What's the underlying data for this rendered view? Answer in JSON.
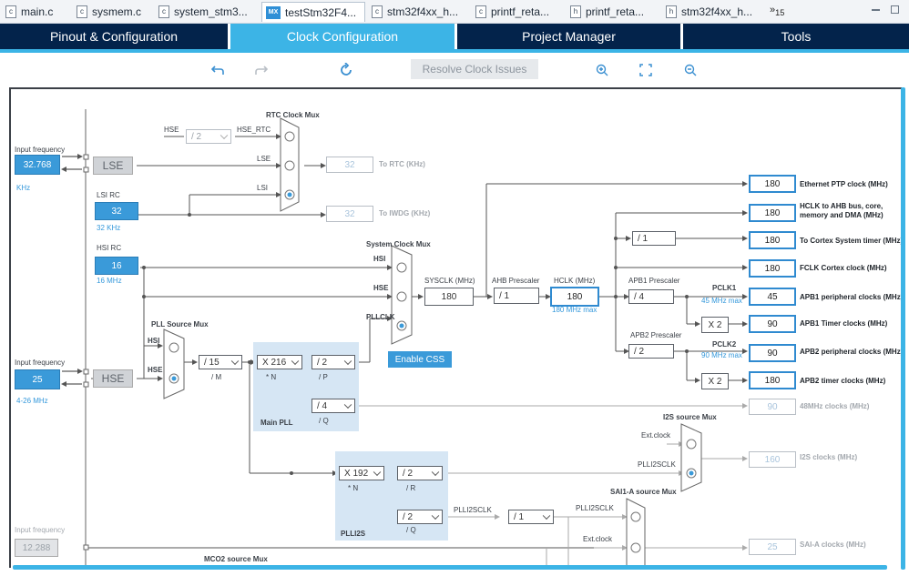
{
  "editor_tabs": [
    {
      "label": "main.c",
      "icon": "c-file-icon"
    },
    {
      "label": "sysmem.c",
      "icon": "c-file-icon"
    },
    {
      "label": "system_stm3...",
      "icon": "c-file-icon"
    },
    {
      "label": "testStm32F4...",
      "icon": "mx-file-icon",
      "active": true
    },
    {
      "label": "stm32f4xx_h...",
      "icon": "c-file-icon"
    },
    {
      "label": "printf_reta...",
      "icon": "c-file-icon"
    },
    {
      "label": "printf_reta...",
      "icon": "h-file-icon"
    },
    {
      "label": "stm32f4xx_h...",
      "icon": "h-file-icon"
    }
  ],
  "overflow_count": "15",
  "mx_icon_text": "MX",
  "main_tabs": [
    {
      "label": "Pinout & Configuration"
    },
    {
      "label": "Clock Configuration",
      "active": true
    },
    {
      "label": "Project Manager"
    },
    {
      "label": "Tools"
    }
  ],
  "toolbar": {
    "resolve_label": "Resolve Clock Issues",
    "icons": [
      "undo-icon",
      "redo-icon",
      "refresh-icon",
      "zoom-in-icon",
      "fit-screen-icon",
      "zoom-out-icon"
    ]
  },
  "accent_color": "#3cb4e6",
  "nav_color": "#03234b",
  "clock": {
    "input_freq_label": "Input frequency",
    "lse_input": "32.768",
    "lse_unit": "KHz",
    "lse_label": "LSE",
    "lsirc_label": "LSI RC",
    "lsi_value": "32",
    "lsi_unit": "32 KHz",
    "hsirc_label": "HSI RC",
    "hsi_value": "16",
    "hsi_unit": "16 MHz",
    "hse_input": "25",
    "hse_range": "4-26 MHz",
    "hse_label": "HSE",
    "bottom_input_label": "Input frequency",
    "bottom_input": "12.288",
    "rtc_mux_title": "RTC Clock Mux",
    "rtc_hse_label": "HSE",
    "rtc_div": "/ 2",
    "hse_rtc_label": "HSE_RTC",
    "rtc_lse_label": "LSE",
    "rtc_lsi_label": "LSI",
    "rtc_value": "32",
    "rtc_out_label": "To RTC (KHz)",
    "iwdg_value": "32",
    "iwdg_out_label": "To IWDG (KHz)",
    "sysmux_title": "System Clock Mux",
    "sysmux_hsi": "HSI",
    "sysmux_hse": "HSE",
    "sysmux_pllclk": "PLLCLK",
    "enable_css": "Enable CSS",
    "sysclk_label": "SYSCLK (MHz)",
    "sysclk_value": "180",
    "ahb_label": "AHB Prescaler",
    "ahb_value": "/ 1",
    "hclk_label": "HCLK (MHz)",
    "hclk_value": "180",
    "hclk_max": "180 MHz max",
    "pll_src_title": "PLL Source Mux",
    "pll_src_hsi": "HSI",
    "pll_src_hse": "HSE",
    "pll_m": "/ 15",
    "pll_m_label": "/ M",
    "pll_n": "X 216",
    "pll_n_label": "* N",
    "pll_p": "/ 2",
    "pll_p_label": "/ P",
    "pll_q": "/ 4",
    "pll_q_label": "/ Q",
    "main_pll_label": "Main PLL",
    "cortex_div": "/ 1",
    "apb1_label": "APB1 Prescaler",
    "apb1_value": "/ 4",
    "pclk1_label": "PCLK1",
    "pclk1_max": "45 MHz max",
    "apb1_timer_mult": "X 2",
    "apb2_label": "APB2 Prescaler",
    "apb2_value": "/ 2",
    "pclk2_label": "PCLK2",
    "pclk2_max": "90 MHz max",
    "apb2_timer_mult": "X 2",
    "outputs": [
      {
        "value": "180",
        "label": "Ethernet PTP clock (MHz)"
      },
      {
        "value": "180",
        "label": "HCLK to AHB bus, core,"
      },
      {
        "value": "180",
        "label": "To Cortex System timer (MHz)"
      },
      {
        "value": "180",
        "label": "FCLK Cortex clock (MHz)"
      },
      {
        "value": "45",
        "label": "APB1 peripheral clocks (MHz)"
      },
      {
        "value": "90",
        "label": "APB1 Timer clocks (MHz)"
      },
      {
        "value": "90",
        "label": "APB2 peripheral clocks (MHz)"
      },
      {
        "value": "180",
        "label": "APB2 timer clocks (MHz)"
      }
    ],
    "hclk_line2": "memory and DMA (MHz)",
    "out48_value": "90",
    "out48_label": "48MHz clocks (MHz)",
    "i2s_mux_title": "I2S source Mux",
    "i2s_ext": "Ext.clock",
    "i2s_plli2sclk": "PLLI2SCLK",
    "i2s_value": "160",
    "i2s_label": "I2S clocks (MHz)",
    "plli2s_n": "X 192",
    "plli2s_n_label": "* N",
    "plli2s_r": "/ 2",
    "plli2s_r_label": "/ R",
    "plli2s_q": "/ 2",
    "plli2s_q_label": "/ Q",
    "plli2s_label": "PLLI2S",
    "plli2sclk_label": "PLLI2SCLK",
    "sai_div": "/ 1",
    "sai_mux_title": "SAI1-A source Mux",
    "sai_plli2sclk": "PLLI2SCLK",
    "sai_ext": "Ext.clock",
    "sai_value": "25",
    "sai_label": "SAI-A clocks (MHz)",
    "mco2_title": "MCO2 source Mux"
  }
}
